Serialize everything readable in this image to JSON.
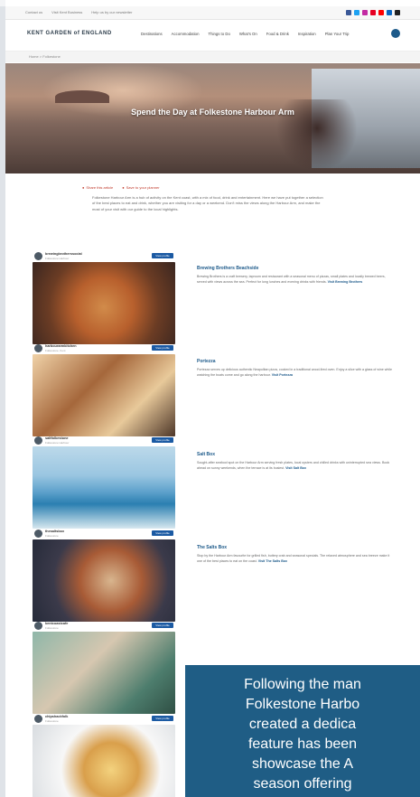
{
  "browser_url": "wcbm - Folkestone Harbour",
  "topbar": {
    "links": [
      "Contact us",
      "Visit Kent Business",
      "Help us by our newsletter"
    ],
    "social_colors": [
      "#3b5998",
      "#1da1f2",
      "#c32aa3",
      "#e60023",
      "#ff0000",
      "#0a66c2",
      "#222222"
    ]
  },
  "nav": {
    "logo": "KENT GARDEN of ENGLAND",
    "menu": [
      "Destinations",
      "Accommodation",
      "Things to Do",
      "What's On",
      "Food & Drink",
      "Inspiration",
      "Plan Your Trip"
    ]
  },
  "breadcrumb": "Home > Folkestone",
  "hero": {
    "title": "Spend the Day at Folkestone Harbour Arm"
  },
  "tags": [
    "Share this article",
    "Save to your planner"
  ],
  "intro": "Folkestone Harbour Arm is a hub of activity on the Kent coast, with a mix of food, drink and entertainment. Here we have put together a selection of the best places to eat and drink, whether you are visiting for a day or a weekend. Don't miss the views along the Harbour Arm, and make the most of your visit with our guide to the local highlights.",
  "articles": [
    {
      "account": "brewingbrotherssocial",
      "account_sub": "Folkestone Harbour",
      "button": "View profile",
      "title": "Brewing Brothers Beachside",
      "body": "Brewing Brothers is a craft brewery, taproom and restaurant with a seasonal menu of pizzas, small plates and locally brewed beers, served with views across the sea. Perfect for long lunches and evening drinks with friends.",
      "link": "Visit Brewing Brothers"
    },
    {
      "account": "harbourarmkitchen",
      "account_sub": "Folkestone, Kent",
      "button": "View profile",
      "title": "Portezza",
      "body": "Portezza serves up delicious authentic Neapolitan pizza, cooked in a traditional wood-fired oven. Enjoy a slice with a glass of wine while watching the boats come and go along the harbour.",
      "link": "Visit Portezza"
    },
    {
      "account": "saltfolkestone",
      "account_sub": "Folkestone Harbour",
      "button": "View profile",
      "title": "Salt Box",
      "body": "Sought-after seafood spot on the Harbour Arm serving fresh plates, local oysters and chilled drinks with uninterrupted sea views. Book ahead on sunny weekends, when the terrace is at its busiest.",
      "link": "Visit Salt Box"
    },
    {
      "account": "thesaltsbox",
      "account_sub": "Folkestone",
      "button": "View profile",
      "title": "The Salts Box",
      "body": "Stop by the Harbour Arm favourite for grilled fish, buttery crab and seasonal specials. The relaxed atmosphere and sea breeze make it one of the best places to eat on the coast.",
      "link": "Visit The Salts Box"
    },
    {
      "account": "kentcoastcafe",
      "account_sub": "Folkestone",
      "button": "View profile",
      "title": "",
      "body": "",
      "link": ""
    },
    {
      "account": "chipshackfolk",
      "account_sub": "Folkestone",
      "button": "View profile",
      "title": "",
      "body": "",
      "link": ""
    }
  ],
  "overlay_text": "Following the man\nFolkestone Harbo\ncreated a dedica\nfeature has been\nshowcase the A\nseason offering\nongoing promotio"
}
